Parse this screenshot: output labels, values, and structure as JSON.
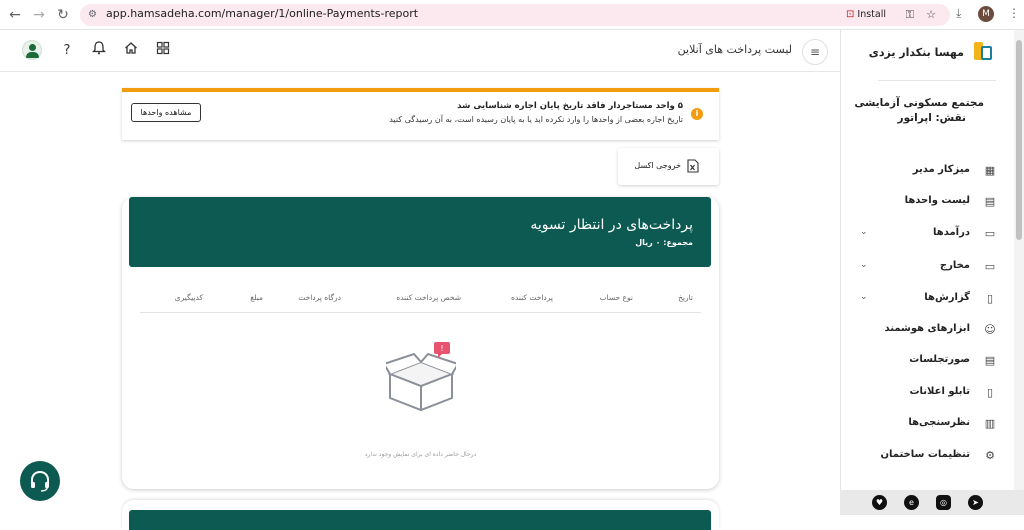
{
  "browser": {
    "url": "app.hamsadeha.com/manager/1/online-Payments-report",
    "install_label": "Install",
    "profile_initial": "M"
  },
  "topbar": {
    "page_title": "لیست پرداخت های آنلاین"
  },
  "sidebar": {
    "brand_name": "مهسا بنکدار یزدی",
    "complex_name": "مجتمع مسکونی آزمایشی",
    "role": "نقش: اپراتور",
    "items": [
      {
        "label": "میزکار مدیر",
        "icon": "dashboard-icon",
        "expandable": false
      },
      {
        "label": "لیست واحدها",
        "icon": "building-icon",
        "expandable": false
      },
      {
        "label": "درآمدها",
        "icon": "income-card-icon",
        "expandable": true
      },
      {
        "label": "مخارج",
        "icon": "expense-card-icon",
        "expandable": true
      },
      {
        "label": "گزارش‌ها",
        "icon": "report-icon",
        "expandable": true
      },
      {
        "label": "ابزارهای هوشمند",
        "icon": "robot-icon",
        "expandable": false
      },
      {
        "label": "صورتجلسات",
        "icon": "minutes-icon",
        "expandable": false
      },
      {
        "label": "تابلو اعلانات",
        "icon": "notice-board-icon",
        "expandable": false
      },
      {
        "label": "نظرسنجی‌ها",
        "icon": "poll-icon",
        "expandable": false
      },
      {
        "label": "تنظیمات ساختمان",
        "icon": "settings-icon",
        "expandable": false
      }
    ]
  },
  "alert": {
    "title": "۵ واحد مستاجردار فاقد تاریخ پایان اجاره شناسایی شد",
    "description": "تاریخ اجاره بعضی از واحدها را وارد نکرده اید یا به پایان رسیده است، به آن رسیدگی کنید",
    "button_label": "مشاهده واحدها"
  },
  "excel": {
    "label": "خروجی اکسل"
  },
  "card": {
    "title": "پرداخت‌های در انتظار تسویه",
    "subtitle": "مجموع: ۰ ریال",
    "columns": [
      "تاریخ",
      "نوع حساب",
      "پرداخت کننده",
      "شخص پرداخت کننده",
      "درگاه پرداخت",
      "مبلغ",
      "کدپیگیری"
    ],
    "empty_text": "درحال حاضر داده ای برای نمایش وجود ندارد"
  },
  "colors": {
    "primary": "#0c5a52",
    "warning": "#f39c12"
  }
}
